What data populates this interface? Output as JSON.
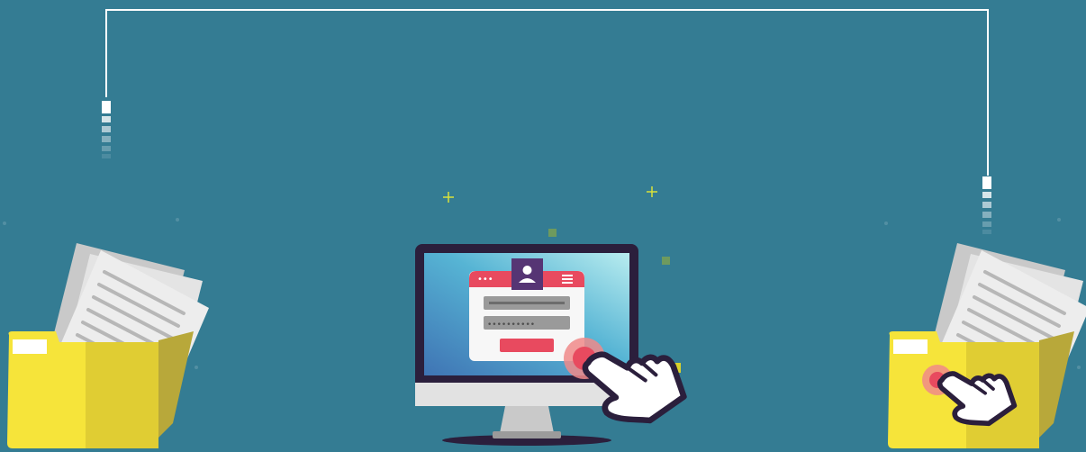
{
  "scene": {
    "background": "#347c93",
    "connector_color": "#ffffff",
    "folder_color": "#f6e43a",
    "folder_shade": "#e0cd33",
    "accent": "#e84a5f",
    "monitor_frame": "#2b1f3c",
    "icons": [
      "folder-icon",
      "document-icon",
      "monitor-icon",
      "user-icon",
      "hamburger-icon",
      "hand-pointer-icon",
      "sparkle-icon"
    ]
  },
  "login": {
    "window_dots": "•••",
    "password_mask": "••••••••••"
  }
}
